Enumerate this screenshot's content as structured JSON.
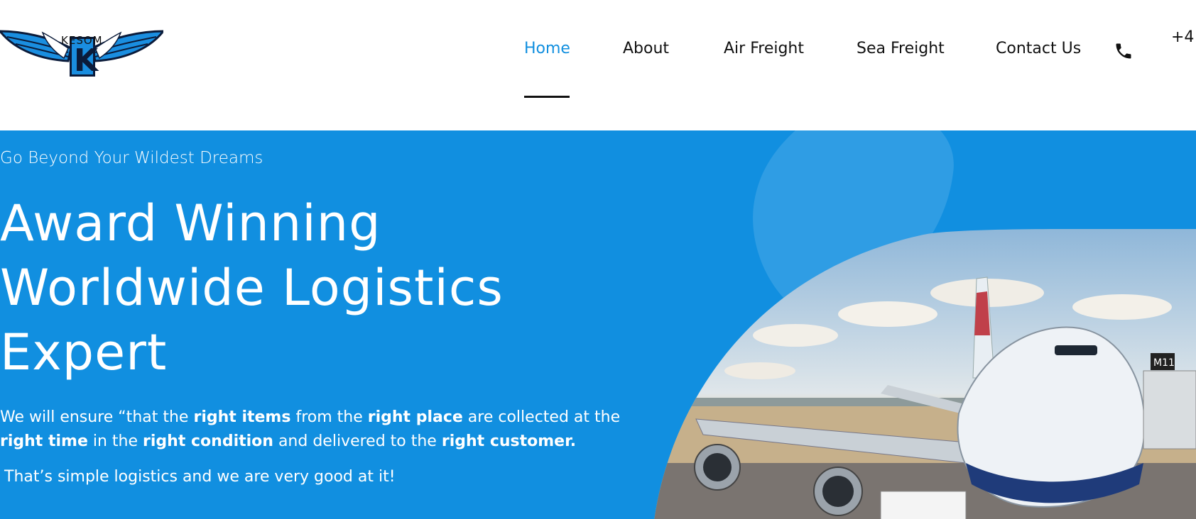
{
  "brand": {
    "name": "KESOM",
    "logo_letter": "K"
  },
  "nav": {
    "items": [
      {
        "label": "Home",
        "active": true
      },
      {
        "label": "About",
        "active": false
      },
      {
        "label": "Air Freight",
        "active": false
      },
      {
        "label": "Sea Freight",
        "active": false
      },
      {
        "label": "Contact Us",
        "active": false
      }
    ],
    "phone_icon": "phone-icon",
    "phone_number": "+4"
  },
  "hero": {
    "eyebrow": "Go Beyond Your Wildest Dreams",
    "headline_lines": [
      "Award Winning",
      "Worldwide Logistics",
      "Expert"
    ],
    "paragraph1": {
      "segments": [
        {
          "text": "We will ensure “that the ",
          "bold": false
        },
        {
          "text": "right items",
          "bold": true
        },
        {
          "text": " from the ",
          "bold": false
        },
        {
          "text": "right place",
          "bold": true
        },
        {
          "text": " are collected at the ",
          "bold": false
        },
        {
          "text": "right time",
          "bold": true
        },
        {
          "text": " in the ",
          "bold": false
        },
        {
          "text": "right condition",
          "bold": true
        },
        {
          "text": " and delivered to the ",
          "bold": false
        },
        {
          "text": "right customer.",
          "bold": true
        }
      ]
    },
    "paragraph2": "That’s simple logistics and we are very good at it!",
    "photo_badge": "M11"
  },
  "colors": {
    "accent": "#118fdf",
    "hero_bg": "#118fe0",
    "nav_text": "#111111",
    "white": "#ffffff"
  }
}
